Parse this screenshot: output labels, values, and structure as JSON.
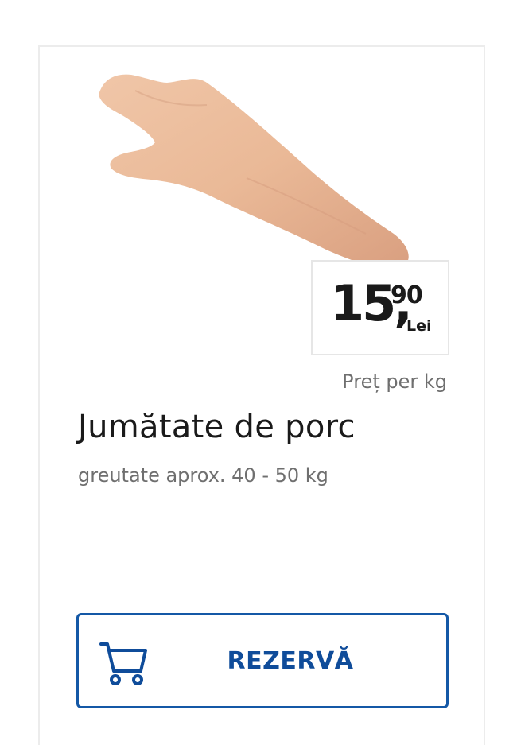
{
  "product": {
    "image_alt": "half pig carcass",
    "title": "Jumătate de porc",
    "subtitle": "greutate aprox. 40 - 50 kg",
    "unit_label": "Preț per kg"
  },
  "price": {
    "integer": "15,",
    "cents": "90",
    "currency": "Lei"
  },
  "actions": {
    "reserve_label": "REZERVĂ",
    "reserve_icon": "shopping-cart-icon"
  },
  "colors": {
    "accent": "#0f4c9a",
    "text": "#1a1a1a",
    "muted": "#6f6f6f"
  }
}
